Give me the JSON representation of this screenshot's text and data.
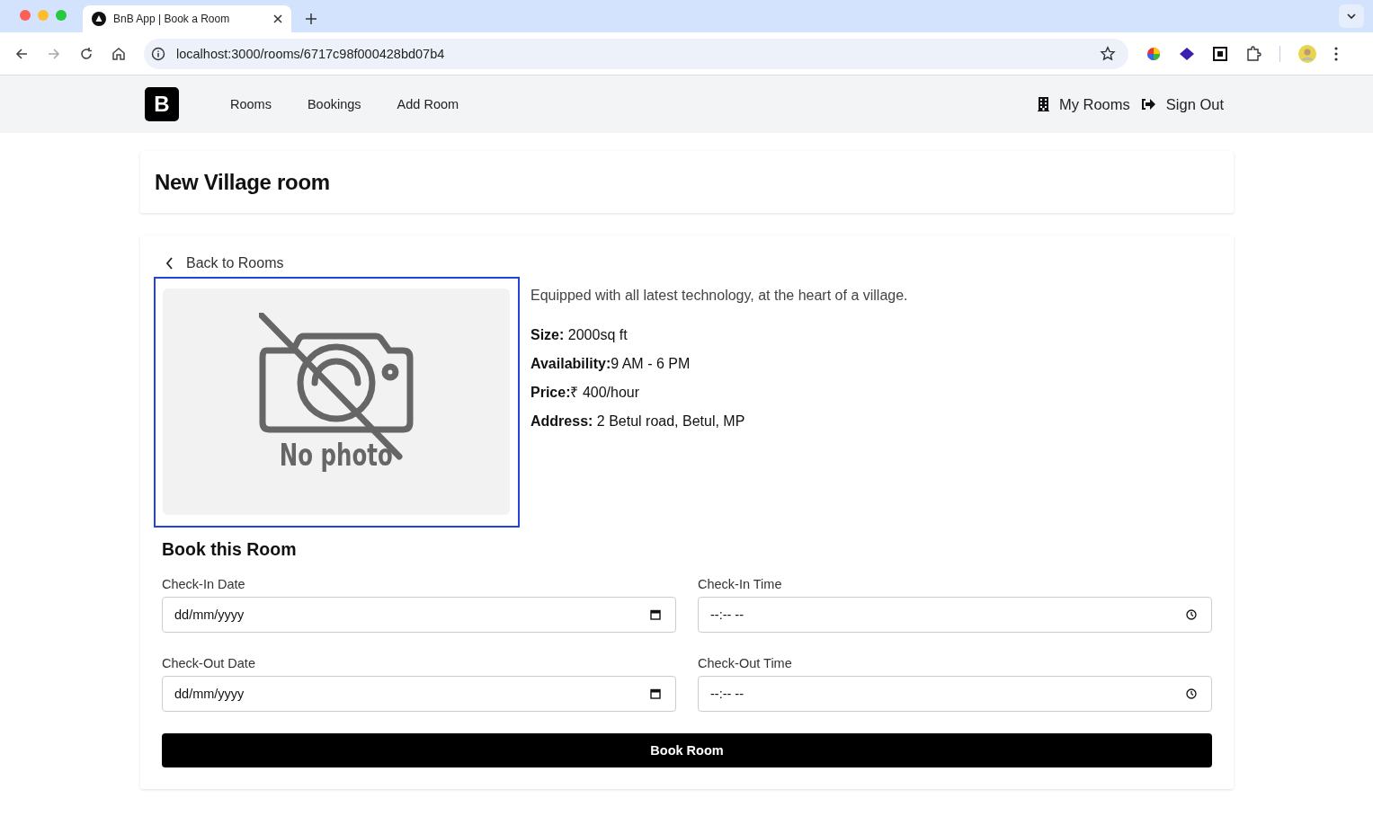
{
  "browser": {
    "tab_title": "BnB App | Book a Room",
    "url": "localhost:3000/rooms/6717c98f000428bd07b4"
  },
  "nav": {
    "logo": "B",
    "links": [
      {
        "label": "Rooms"
      },
      {
        "label": "Bookings"
      },
      {
        "label": "Add Room"
      }
    ],
    "right": [
      {
        "kind": "rooms",
        "label": "My Rooms"
      },
      {
        "kind": "signout",
        "label": "Sign Out"
      }
    ]
  },
  "page": {
    "title": "New Village room"
  },
  "room": {
    "back_link": "Back to Rooms",
    "image_caption": "No photo",
    "description": "Equipped with all latest technology, at the heart of a village.",
    "details": [
      "**Size:** 2000sq ft",
      "**Availability:**9 AM - 6 PM",
      "**Price:**₹ 400/hour",
      "**Address:** 2 Betul road, Betul, MP"
    ]
  },
  "booking": {
    "title": "Book this Room",
    "fields": [
      {
        "kind": "date",
        "label": "Check-In Date",
        "placeholder": "dd/mm/yyyy"
      },
      {
        "kind": "time",
        "label": "Check-In Time",
        "placeholder": "--:-- --"
      },
      {
        "kind": "date",
        "label": "Check-Out Date",
        "placeholder": "dd/mm/yyyy"
      },
      {
        "kind": "time",
        "label": "Check-Out Time",
        "placeholder": "--:-- --"
      }
    ],
    "button": "Book Room"
  }
}
